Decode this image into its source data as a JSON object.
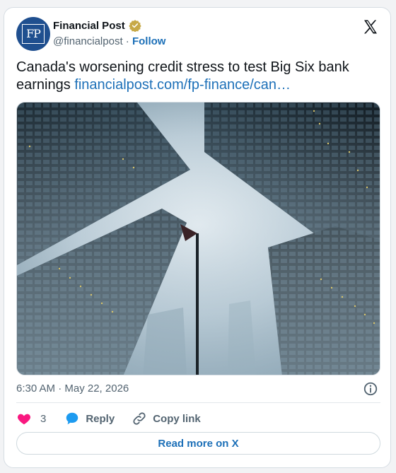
{
  "author": {
    "name": "Financial Post",
    "handle": "@financialpost",
    "separator": "·",
    "follow_label": "Follow",
    "avatar_text": "FP"
  },
  "tweet": {
    "text": "Canada's worsening credit stress to test Big Six bank earnings",
    "link": "financialpost.com/fp-finance/can…"
  },
  "meta": {
    "timestamp": "6:30 AM · May 22, 2026"
  },
  "actions": {
    "like_count": "3",
    "reply_label": "Reply",
    "copy_label": "Copy link"
  },
  "read_more_label": "Read more on X",
  "icons": {
    "verified": "verified-badge-icon",
    "x_logo": "x-logo-icon",
    "info": "info-icon",
    "like": "heart-icon",
    "reply": "reply-bubble-icon",
    "copy": "link-icon"
  },
  "colors": {
    "accent": "#1d70b8",
    "like": "#f91880",
    "verified": "#c7a948",
    "avatar": "#1f4f8f"
  }
}
